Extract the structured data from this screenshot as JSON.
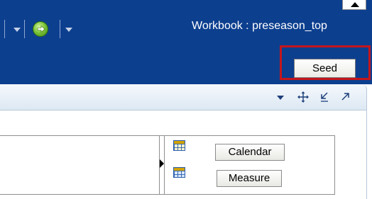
{
  "header": {
    "workbook_title": "Workbook : preseason_top",
    "background_color": "#0d3f8f",
    "icons": [
      "dropdown-arrow-icon",
      "go-icon",
      "collapse-up-icon"
    ]
  },
  "seed_button": {
    "label": "Seed",
    "highlight_color": "#c4161c"
  },
  "panel": {
    "toolbar_icons": [
      "menu-dropdown-icon",
      "move-icon",
      "minimize-icon",
      "maximize-icon"
    ]
  },
  "dimensions": [
    {
      "label": "Calendar",
      "icon": "calendar-grid-icon"
    },
    {
      "label": "Measure",
      "icon": "measure-grid-icon"
    }
  ]
}
